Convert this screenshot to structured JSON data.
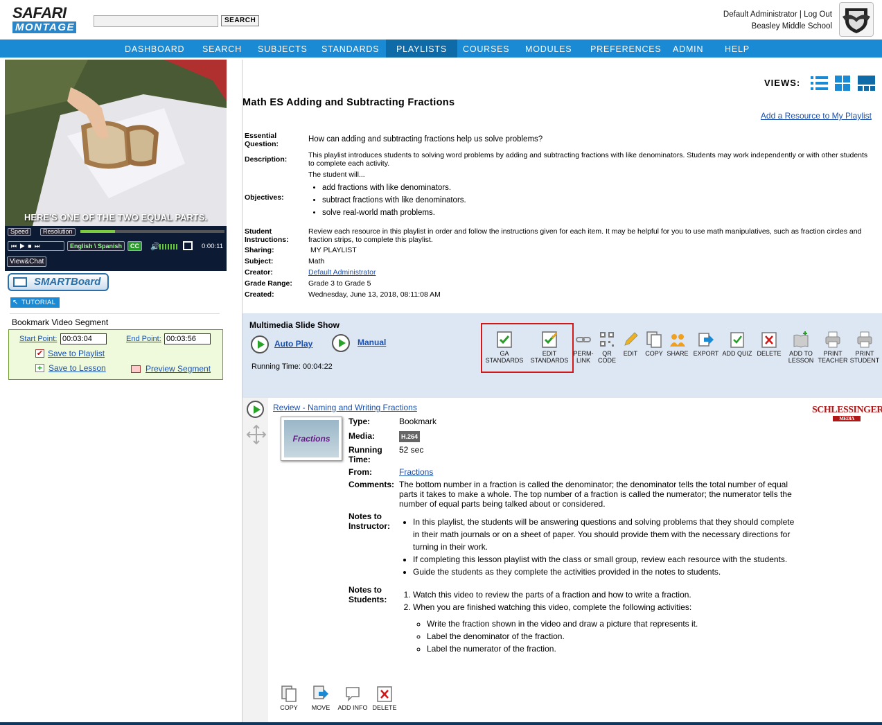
{
  "header": {
    "logo_top": "SAFARI",
    "logo_bottom": "MONTAGE",
    "search_placeholder": "",
    "search_button": "SEARCH",
    "user": "Default Administrator",
    "sep": "|",
    "logout": "Log Out",
    "school": "Beasley Middle School"
  },
  "nav": [
    "DASHBOARD",
    "SEARCH",
    "SUBJECTS",
    "STANDARDS",
    "PLAYLISTS",
    "COURSES",
    "MODULES",
    "PREFERENCES",
    "ADMIN",
    "HELP"
  ],
  "video": {
    "caption": "HERE'S ONE OF THE TWO EQUAL PARTS.",
    "speed": "Speed",
    "resolution": "Resolution",
    "lang": "English \\ Spanish",
    "cc": "CC",
    "time": "0:00:11",
    "viewchat": "View&Chat",
    "progress": 0.24
  },
  "smartboard": "SMARTBoard",
  "tutorial": "TUTORIAL",
  "bookmark": {
    "title": "Bookmark Video Segment",
    "start_label": "Start Point:",
    "start_value": "00:03:04",
    "end_label": "End Point:",
    "end_value": "00:03:56",
    "save_playlist": "Save to Playlist",
    "save_lesson": "Save to Lesson",
    "preview": "Preview Segment"
  },
  "views_label": "VIEWS:",
  "playlist": {
    "title": "Math ES Adding and Subtracting Fractions",
    "add_resource": "Add a Resource to My Playlist",
    "essential_label": "Essential Question:",
    "essential": "How can adding and subtracting fractions help us solve problems?",
    "description_label": "Description:",
    "description": "This playlist introduces students to solving word problems by adding and subtracting fractions with like denominators. Students may work independently or with other students to complete each activity.",
    "objectives_label": "Objectives:",
    "objectives_intro": "The student will...",
    "objectives": [
      "add fractions with like denominators.",
      "subtract fractions with like denominators.",
      "solve real-world math problems."
    ],
    "student_instr_label": "Student Instructions:",
    "student_instr": "Review each resource in this playlist in order and follow the instructions given for each item. It may be helpful for you to use math manipulatives, such as fraction circles and fraction strips, to complete this playlist.",
    "sharing_label": "Sharing:",
    "sharing": "MY PLAYLIST",
    "subject_label": "Subject:",
    "subject": "Math",
    "creator_label": "Creator:",
    "creator": "Default Administrator",
    "grade_label": "Grade Range:",
    "grade": "Grade 3 to Grade 5",
    "created_label": "Created:",
    "created": "Wednesday, June 13, 2018, 08:11:08 AM"
  },
  "slideshow": {
    "title": "Multimedia Slide Show",
    "autoplay": "Auto Play",
    "manual": "Manual",
    "running_time": "Running Time: 00:04:22"
  },
  "toolbar": [
    {
      "l1": "GA",
      "l2": "STANDARDS",
      "icon": "ga-standards-icon"
    },
    {
      "l1": "EDIT",
      "l2": "STANDARDS",
      "icon": "edit-standards-icon"
    },
    {
      "l1": "PERM-",
      "l2": "LINK",
      "icon": "permalink-icon"
    },
    {
      "l1": "QR",
      "l2": "CODE",
      "icon": "qr-code-icon"
    },
    {
      "l1": "EDIT",
      "l2": "",
      "icon": "edit-pencil-icon"
    },
    {
      "l1": "COPY",
      "l2": "",
      "icon": "copy-icon"
    },
    {
      "l1": "SHARE",
      "l2": "",
      "icon": "share-icon"
    },
    {
      "l1": "EXPORT",
      "l2": "",
      "icon": "export-icon"
    },
    {
      "l1": "ADD QUIZ",
      "l2": "",
      "icon": "add-quiz-icon"
    },
    {
      "l1": "DELETE",
      "l2": "",
      "icon": "delete-icon"
    },
    {
      "l1": "ADD TO",
      "l2": "LESSON",
      "icon": "add-to-lesson-icon"
    },
    {
      "l1": "PRINT",
      "l2": "TEACHER",
      "icon": "print-teacher-icon"
    },
    {
      "l1": "PRINT",
      "l2": "STUDENT",
      "icon": "print-student-icon"
    }
  ],
  "resource": {
    "title": "Review - Naming and Writing Fractions",
    "thumb_text": "Fractions",
    "brand": "SCHLESSINGER",
    "brand_sub": "MEDIA",
    "type_label": "Type:",
    "type": "Bookmark",
    "media_label": "Media:",
    "media": "H.264",
    "rt_label": "Running Time:",
    "rt": "52 sec",
    "from_label": "From:",
    "from": "Fractions",
    "comments_label": "Comments:",
    "comments": "The bottom number in a fraction is called the denominator; the denominator tells the total number of equal parts it takes to make a whole. The top number of a fraction is called the numerator; the numerator tells the number of equal parts being talked about or considered.",
    "instr_label": "Notes to Instructor:",
    "instr": [
      "In this playlist, the students will be answering questions and solving problems that they should complete in their math journals or on a sheet of paper. You should provide them with the necessary directions for turning in their work.",
      "If completing this lesson playlist with the class or small group, review each resource with the students.",
      "Guide the students as they complete the activities provided in the notes to students."
    ],
    "stud_label": "Notes to Students:",
    "stud": [
      "Watch this video to review the parts of a fraction and how to write a fraction.",
      "When you are finished watching this video, complete the following activities:"
    ],
    "stud_sub": [
      "Write the fraction shown in the video and draw a picture that represents it.",
      "Label the denominator of the fraction.",
      "Label the numerator of the fraction."
    ]
  },
  "item_toolbar": [
    "COPY",
    "MOVE",
    "ADD INFO",
    "DELETE"
  ],
  "colors": {
    "nav": "#1a8ad4",
    "nav_active": "#0f6aa8",
    "toolbar_bg": "#dde6f3",
    "highlight": "#d01818",
    "link": "#1a50b0"
  }
}
